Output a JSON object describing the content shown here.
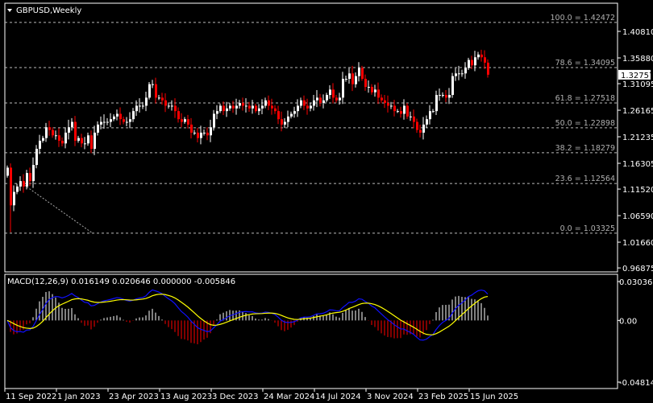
{
  "window": {
    "title": "GBPUSD,Weekly"
  },
  "price_axis": {
    "ticks": [
      "1.40810",
      "1.35880",
      "1.31095",
      "1.26165",
      "1.21235",
      "1.16305",
      "1.11520",
      "1.06590",
      "1.01660",
      "0.96875"
    ],
    "tick_values": [
      1.4081,
      1.3588,
      1.31095,
      1.26165,
      1.21235,
      1.16305,
      1.1152,
      1.0659,
      1.0166,
      0.96875
    ],
    "current_price": "1.32757"
  },
  "fibonacci": [
    {
      "label": "100.0 = 1.42472",
      "value": 1.42472
    },
    {
      "label": "78.6 = 1.34095",
      "value": 1.34095
    },
    {
      "label": "61.8 = 1.27518",
      "value": 1.27518
    },
    {
      "label": "50.0 = 1.22898",
      "value": 1.22898
    },
    {
      "label": "38.2 = 1.18279",
      "value": 1.18279
    },
    {
      "label": "23.6 = 1.12564",
      "value": 1.12564
    },
    {
      "label": "0.0 = 1.03325",
      "value": 1.03325
    }
  ],
  "macd": {
    "label": "MACD(12,26,9) 0.016149 0.020646 0.000000 -0.005846",
    "ticks": [
      "0.030361",
      "0.00",
      "-0.048141"
    ],
    "tick_values": [
      0.030361,
      0,
      -0.048141
    ],
    "colors": {
      "macd": "#1010ff",
      "signal": "#ffff00",
      "hist_pos": "#ffffff",
      "hist_neg": "#ff0000"
    }
  },
  "time_axis": [
    "11 Sep 2022",
    "1 Jan 2023",
    "23 Apr 2023",
    "13 Aug 2023",
    "3 Dec 2023",
    "24 Mar 2024",
    "14 Jul 2024",
    "3 Nov 2024",
    "23 Feb 2025",
    "15 Jun 2025"
  ],
  "chart_data": {
    "type": "candlestick",
    "symbol": "GBPUSD",
    "timeframe": "Weekly",
    "ylim": [
      0.96875,
      1.42472
    ],
    "colors": {
      "bull": "#ffffff",
      "bear": "#ff0000"
    },
    "closes": [
      1.155,
      1.085,
      1.11,
      1.12,
      1.13,
      1.12,
      1.145,
      1.13,
      1.16,
      1.19,
      1.205,
      1.21,
      1.23,
      1.225,
      1.215,
      1.215,
      1.205,
      1.2,
      1.22,
      1.23,
      1.24,
      1.205,
      1.21,
      1.2,
      1.2,
      1.215,
      1.19,
      1.22,
      1.235,
      1.24,
      1.24,
      1.24,
      1.245,
      1.25,
      1.255,
      1.245,
      1.24,
      1.24,
      1.245,
      1.26,
      1.27,
      1.27,
      1.27,
      1.285,
      1.31,
      1.31,
      1.285,
      1.285,
      1.28,
      1.27,
      1.27,
      1.27,
      1.26,
      1.245,
      1.24,
      1.245,
      1.235,
      1.22,
      1.22,
      1.21,
      1.22,
      1.22,
      1.215,
      1.23,
      1.255,
      1.26,
      1.27,
      1.26,
      1.265,
      1.27,
      1.265,
      1.27,
      1.275,
      1.27,
      1.27,
      1.265,
      1.27,
      1.26,
      1.265,
      1.27,
      1.28,
      1.27,
      1.265,
      1.26,
      1.245,
      1.235,
      1.24,
      1.25,
      1.255,
      1.26,
      1.27,
      1.28,
      1.27,
      1.265,
      1.27,
      1.28,
      1.285,
      1.275,
      1.28,
      1.29,
      1.3,
      1.285,
      1.28,
      1.285,
      1.32,
      1.32,
      1.33,
      1.31,
      1.325,
      1.34,
      1.32,
      1.305,
      1.305,
      1.295,
      1.3,
      1.285,
      1.28,
      1.275,
      1.27,
      1.27,
      1.26,
      1.26,
      1.255,
      1.27,
      1.25,
      1.25,
      1.24,
      1.225,
      1.22,
      1.235,
      1.245,
      1.26,
      1.26,
      1.29,
      1.29,
      1.29,
      1.285,
      1.29,
      1.325,
      1.33,
      1.33,
      1.33,
      1.34,
      1.355,
      1.345,
      1.36,
      1.365,
      1.36,
      1.35,
      1.3276
    ],
    "first_open": 1.14,
    "first_low": 1.035
  }
}
